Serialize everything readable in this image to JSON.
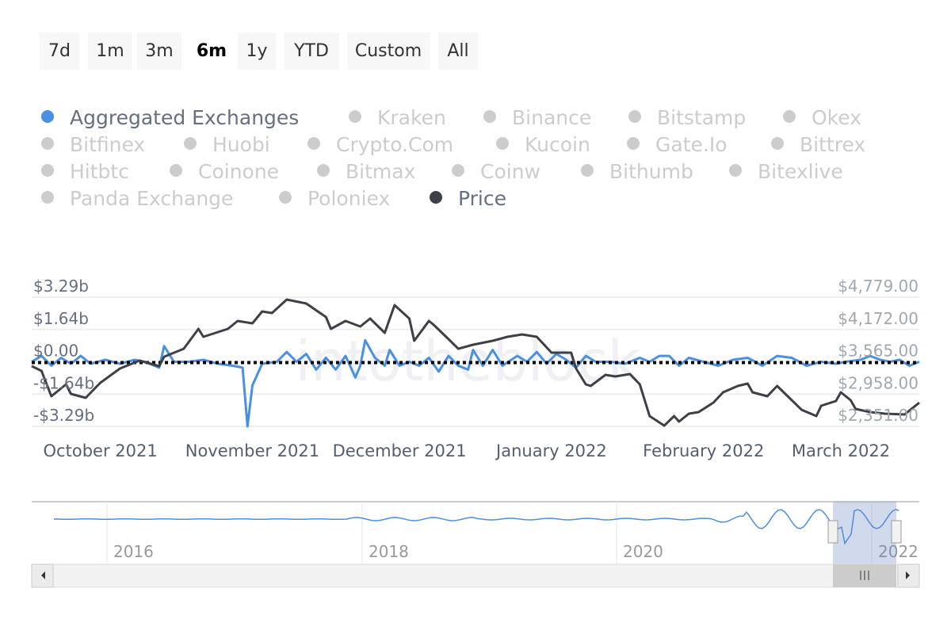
{
  "range_selector": {
    "buttons": [
      "7d",
      "1m",
      "3m",
      "6m",
      "1y",
      "YTD",
      "Custom",
      "All"
    ],
    "selected": "6m"
  },
  "legend": {
    "items": [
      {
        "label": "Aggregated Exchanges",
        "active": true,
        "color": "#4a90e2"
      },
      {
        "label": "Kraken",
        "active": false
      },
      {
        "label": "Binance",
        "active": false
      },
      {
        "label": "Bitstamp",
        "active": false
      },
      {
        "label": "Okex",
        "active": false
      },
      {
        "label": "Bitfinex",
        "active": false
      },
      {
        "label": "Huobi",
        "active": false
      },
      {
        "label": "Crypto.Com",
        "active": false
      },
      {
        "label": "Kucoin",
        "active": false
      },
      {
        "label": "Gate.Io",
        "active": false
      },
      {
        "label": "Bittrex",
        "active": false
      },
      {
        "label": "Hitbtc",
        "active": false
      },
      {
        "label": "Coinone",
        "active": false
      },
      {
        "label": "Bitmax",
        "active": false
      },
      {
        "label": "Coinw",
        "active": false
      },
      {
        "label": "Bithumb",
        "active": false
      },
      {
        "label": "Bitexlive",
        "active": false
      },
      {
        "label": "Panda Exchange",
        "active": false
      },
      {
        "label": "Poloniex",
        "active": false
      },
      {
        "label": "Price",
        "active": true,
        "color": "#3d4147"
      }
    ]
  },
  "watermark": "intotheblock",
  "chart_data": {
    "type": "line",
    "x_range": [
      "2021-09-17",
      "2022-03-17"
    ],
    "x_ticks": [
      "October 2021",
      "November 2021",
      "December 2021",
      "January 2022",
      "February 2022",
      "March 2022"
    ],
    "y_left": {
      "ticks": [
        "$3.29b",
        "$1.64b",
        "$0.00",
        "-$1.64b",
        "-$3.29b"
      ],
      "range": [
        -3.29,
        3.29
      ],
      "unit": "billion USD"
    },
    "y_right": {
      "ticks": [
        "$4,779.00",
        "$4,172.00",
        "$3,565.00",
        "$2,958.00",
        "$2,351.00"
      ],
      "range": [
        2351,
        4779
      ]
    },
    "zero_line": "dotted",
    "series": [
      {
        "name": "Aggregated Exchanges",
        "axis": "left",
        "color": "#4a90e2",
        "points": [
          [
            "2021-09-17",
            0.0
          ],
          [
            "2021-09-19",
            0.3
          ],
          [
            "2021-09-21",
            -0.2
          ],
          [
            "2021-09-23",
            0.2
          ],
          [
            "2021-09-25",
            -0.1
          ],
          [
            "2021-09-27",
            0.3
          ],
          [
            "2021-09-29",
            -0.1
          ],
          [
            "2021-10-02",
            0.1
          ],
          [
            "2021-10-05",
            -0.1
          ],
          [
            "2021-10-08",
            0.1
          ],
          [
            "2021-10-10",
            0.0
          ],
          [
            "2021-10-13",
            -0.3
          ],
          [
            "2021-10-14",
            0.8
          ],
          [
            "2021-10-16",
            0.0
          ],
          [
            "2021-10-19",
            0.0
          ],
          [
            "2021-10-22",
            0.1
          ],
          [
            "2021-10-25",
            -0.1
          ],
          [
            "2021-10-28",
            -0.2
          ],
          [
            "2021-10-30",
            -0.3
          ],
          [
            "2021-10-31",
            -3.29
          ],
          [
            "2021-11-01",
            -1.2
          ],
          [
            "2021-11-03",
            -0.1
          ],
          [
            "2021-11-06",
            0.0
          ],
          [
            "2021-11-08",
            0.5
          ],
          [
            "2021-11-10",
            0.0
          ],
          [
            "2021-11-12",
            0.4
          ],
          [
            "2021-11-14",
            -0.4
          ],
          [
            "2021-11-16",
            0.2
          ],
          [
            "2021-11-18",
            -0.4
          ],
          [
            "2021-11-20",
            0.3
          ],
          [
            "2021-11-22",
            -0.8
          ],
          [
            "2021-11-23",
            -0.2
          ],
          [
            "2021-11-24",
            1.1
          ],
          [
            "2021-11-26",
            0.2
          ],
          [
            "2021-11-28",
            -0.2
          ],
          [
            "2021-11-29",
            0.6
          ],
          [
            "2021-12-01",
            -0.2
          ],
          [
            "2021-12-03",
            0.0
          ],
          [
            "2021-12-05",
            -0.2
          ],
          [
            "2021-12-07",
            0.2
          ],
          [
            "2021-12-09",
            -0.5
          ],
          [
            "2021-12-11",
            0.3
          ],
          [
            "2021-12-13",
            -0.2
          ],
          [
            "2021-12-15",
            -0.4
          ],
          [
            "2021-12-16",
            0.6
          ],
          [
            "2021-12-18",
            -0.2
          ],
          [
            "2021-12-20",
            0.6
          ],
          [
            "2021-12-22",
            -0.2
          ],
          [
            "2021-12-25",
            0.3
          ],
          [
            "2021-12-27",
            0.0
          ],
          [
            "2021-12-29",
            0.5
          ],
          [
            "2021-12-31",
            -0.1
          ],
          [
            "2022-01-02",
            0.4
          ],
          [
            "2022-01-04",
            0.1
          ],
          [
            "2022-01-06",
            -0.3
          ],
          [
            "2022-01-08",
            0.3
          ],
          [
            "2022-01-10",
            0.0
          ],
          [
            "2022-01-13",
            0.0
          ],
          [
            "2022-01-16",
            -0.1
          ],
          [
            "2022-01-19",
            0.2
          ],
          [
            "2022-01-21",
            0.0
          ],
          [
            "2022-01-23",
            0.3
          ],
          [
            "2022-01-25",
            0.3
          ],
          [
            "2022-01-27",
            -0.2
          ],
          [
            "2022-01-29",
            0.2
          ],
          [
            "2022-02-01",
            0.0
          ],
          [
            "2022-02-04",
            -0.2
          ],
          [
            "2022-02-07",
            0.1
          ],
          [
            "2022-02-10",
            0.2
          ],
          [
            "2022-02-13",
            -0.2
          ],
          [
            "2022-02-16",
            0.3
          ],
          [
            "2022-02-19",
            0.2
          ],
          [
            "2022-02-22",
            -0.2
          ],
          [
            "2022-02-25",
            0.0
          ],
          [
            "2022-02-28",
            -0.1
          ],
          [
            "2022-03-02",
            0.0
          ],
          [
            "2022-03-05",
            0.1
          ],
          [
            "2022-03-07",
            0.3
          ],
          [
            "2022-03-09",
            0.1
          ],
          [
            "2022-03-11",
            0.0
          ],
          [
            "2022-03-13",
            0.1
          ],
          [
            "2022-03-15",
            -0.2
          ],
          [
            "2022-03-17",
            0.0
          ]
        ]
      },
      {
        "name": "Price",
        "axis": "right",
        "color": "#3d4147",
        "points": [
          [
            "2021-09-17",
            3483
          ],
          [
            "2021-09-19",
            3393
          ],
          [
            "2021-09-21",
            2917
          ],
          [
            "2021-09-24",
            3140
          ],
          [
            "2021-09-25",
            2961
          ],
          [
            "2021-09-28",
            2887
          ],
          [
            "2021-10-01",
            3170
          ],
          [
            "2021-10-05",
            3438
          ],
          [
            "2021-10-09",
            3587
          ],
          [
            "2021-10-13",
            3483
          ],
          [
            "2021-10-14",
            3661
          ],
          [
            "2021-10-18",
            3810
          ],
          [
            "2021-10-21",
            4183
          ],
          [
            "2021-10-22",
            4034
          ],
          [
            "2021-10-27",
            4183
          ],
          [
            "2021-10-29",
            4332
          ],
          [
            "2021-11-01",
            4287
          ],
          [
            "2021-11-03",
            4511
          ],
          [
            "2021-11-05",
            4481
          ],
          [
            "2021-11-08",
            4734
          ],
          [
            "2021-11-12",
            4660
          ],
          [
            "2021-11-16",
            4407
          ],
          [
            "2021-11-17",
            4183
          ],
          [
            "2021-11-20",
            4332
          ],
          [
            "2021-11-23",
            4228
          ],
          [
            "2021-11-25",
            4377
          ],
          [
            "2021-11-28",
            4109
          ],
          [
            "2021-11-30",
            4630
          ],
          [
            "2021-12-03",
            4377
          ],
          [
            "2021-12-04",
            3960
          ],
          [
            "2021-12-07",
            4332
          ],
          [
            "2021-12-08",
            4257
          ],
          [
            "2021-12-11",
            3989
          ],
          [
            "2021-12-13",
            3810
          ],
          [
            "2021-12-16",
            3885
          ],
          [
            "2021-12-20",
            3960
          ],
          [
            "2021-12-23",
            4034
          ],
          [
            "2021-12-26",
            4079
          ],
          [
            "2021-12-29",
            4034
          ],
          [
            "2022-01-01",
            3736
          ],
          [
            "2022-01-05",
            3736
          ],
          [
            "2022-01-06",
            3438
          ],
          [
            "2022-01-08",
            3140
          ],
          [
            "2022-01-09",
            3110
          ],
          [
            "2022-01-12",
            3319
          ],
          [
            "2022-01-14",
            3289
          ],
          [
            "2022-01-17",
            3334
          ],
          [
            "2022-01-19",
            3140
          ],
          [
            "2022-01-21",
            2544
          ],
          [
            "2022-01-24",
            2365
          ],
          [
            "2022-01-26",
            2544
          ],
          [
            "2022-01-27",
            2440
          ],
          [
            "2022-01-29",
            2589
          ],
          [
            "2022-01-31",
            2619
          ],
          [
            "2022-02-03",
            2797
          ],
          [
            "2022-02-05",
            2991
          ],
          [
            "2022-02-08",
            3110
          ],
          [
            "2022-02-10",
            3155
          ],
          [
            "2022-02-11",
            2991
          ],
          [
            "2022-02-14",
            2917
          ],
          [
            "2022-02-16",
            3110
          ],
          [
            "2022-02-19",
            2842
          ],
          [
            "2022-02-21",
            2663
          ],
          [
            "2022-02-24",
            2544
          ],
          [
            "2022-02-25",
            2738
          ],
          [
            "2022-02-28",
            2827
          ],
          [
            "2022-03-01",
            2991
          ],
          [
            "2022-03-03",
            2842
          ],
          [
            "2022-03-04",
            2678
          ],
          [
            "2022-03-07",
            2619
          ],
          [
            "2022-03-10",
            2589
          ],
          [
            "2022-03-14",
            2574
          ],
          [
            "2022-03-17",
            2797
          ]
        ]
      }
    ],
    "navigator": {
      "x_ticks": [
        "2016",
        "2018",
        "2020",
        "2022"
      ],
      "selected_range": [
        "2021-09-17",
        "2022-03-17"
      ]
    }
  }
}
